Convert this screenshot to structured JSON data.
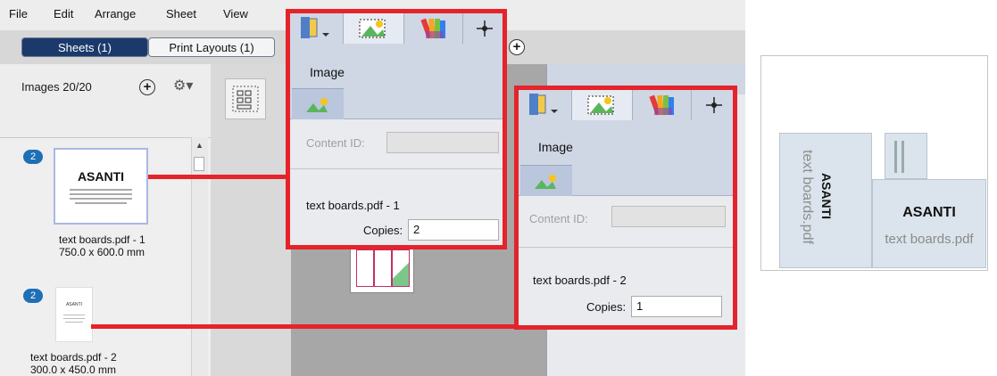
{
  "menu": [
    "File",
    "Edit",
    "Arrange",
    "Sheet",
    "View"
  ],
  "tabs": {
    "sheets": "Sheets (1)",
    "print_layouts": "Print Layouts (1)"
  },
  "images_panel": {
    "count_label": "Images 20/20",
    "items": [
      {
        "badge": "2",
        "title": "ASANTI",
        "name": "text boards.pdf - 1",
        "size": "750.0 x 600.0 mm"
      },
      {
        "badge": "2",
        "title": "ASANTI",
        "name": "text boards.pdf - 2",
        "size": "300.0 x 450.0 mm"
      }
    ]
  },
  "panel_1": {
    "tab_label": "Image",
    "content_id_label": "Content ID:",
    "file_name": "text boards.pdf - 1",
    "copies_label": "Copies:",
    "copies_value": "2"
  },
  "panel_2": {
    "tab_label": "Image",
    "content_id_label": "Content ID:",
    "file_name": "text boards.pdf - 2",
    "copies_label": "Copies:",
    "copies_value": "1"
  },
  "preview": {
    "title_text": "ASANTI",
    "watermark": "text boards.pdf"
  },
  "colors": {
    "highlight": "#e5232a",
    "badge": "#1e6fb6",
    "active_tab": "#1b3a6b",
    "panel_header": "#cfd6e4"
  }
}
